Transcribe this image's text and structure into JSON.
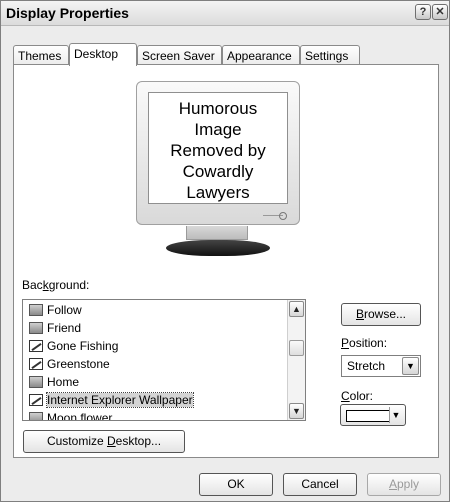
{
  "window": {
    "title": "Display Properties",
    "help_glyph": "?",
    "close_glyph": "✕"
  },
  "tabs": [
    "Themes",
    "Desktop",
    "Screen Saver",
    "Appearance",
    "Settings"
  ],
  "active_tab": "Desktop",
  "preview": {
    "lines": [
      "Humorous",
      "Image",
      "Removed by",
      "Cowardly",
      "Lawyers"
    ]
  },
  "background": {
    "label_pre": "Bac",
    "label_key": "k",
    "label_post": "ground:",
    "items": [
      {
        "label": "Follow",
        "icon": "image-file-icon"
      },
      {
        "label": "Friend",
        "icon": "image-file-icon"
      },
      {
        "label": "Gone Fishing",
        "icon": "picture-icon"
      },
      {
        "label": "Greenstone",
        "icon": "picture-icon"
      },
      {
        "label": "Home",
        "icon": "image-file-icon"
      },
      {
        "label": "Internet Explorer Wallpaper",
        "icon": "picture-icon",
        "selected": true
      },
      {
        "label": "Moon flower",
        "icon": "image-file-icon"
      }
    ]
  },
  "browse": {
    "pre": "",
    "key": "B",
    "post": "rowse..."
  },
  "position": {
    "label_pre": "",
    "label_key": "P",
    "label_post": "osition:",
    "value": "Stretch"
  },
  "color": {
    "label_pre": "",
    "label_key": "C",
    "label_post": "olor:",
    "value": "#ffffff"
  },
  "customize": {
    "pre": "Customize ",
    "key": "D",
    "post": "esktop..."
  },
  "footer": {
    "ok": "OK",
    "cancel": "Cancel",
    "apply_pre": "",
    "apply_key": "A",
    "apply_post": "pply"
  }
}
